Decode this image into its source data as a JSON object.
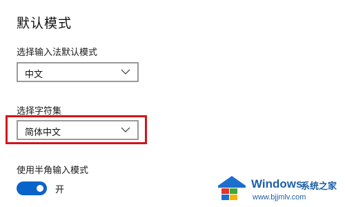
{
  "section": {
    "title": "默认模式"
  },
  "input_default": {
    "label": "选择输入法默认模式",
    "value": "中文"
  },
  "charset": {
    "label": "选择字符集",
    "value": "简体中文",
    "highlight_color": "#d0151a"
  },
  "halfwidth": {
    "label": "使用半角输入模式",
    "state": "开",
    "on": true,
    "accent_color": "#0a63c9"
  },
  "watermark": {
    "logo_icon": "windows-logo",
    "brand": "Windows",
    "site_name": "系统之家",
    "url": "www.bjjmlv.com"
  }
}
